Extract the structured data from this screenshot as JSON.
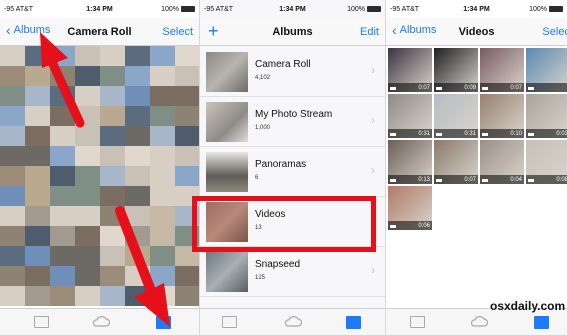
{
  "panel1": {
    "status": {
      "carrier": "-95 AT&T",
      "time": "1:34 PM",
      "battery": "100%"
    },
    "nav": {
      "back_label": "Albums",
      "title": "Camera Roll",
      "action": "Select"
    }
  },
  "panel2": {
    "status": {
      "carrier": "-95 AT&T",
      "time": "1:34 PM",
      "battery": "100%"
    },
    "nav": {
      "add": "+",
      "title": "Albums",
      "action": "Edit"
    },
    "albums": [
      {
        "name": "Camera Roll",
        "count": "4,102"
      },
      {
        "name": "My Photo Stream",
        "count": "1,000"
      },
      {
        "name": "Panoramas",
        "count": "6"
      },
      {
        "name": "Videos",
        "count": "13"
      },
      {
        "name": "Snapseed",
        "count": "125"
      }
    ]
  },
  "panel3": {
    "status": {
      "carrier": "-95 AT&T",
      "time": "1:34 PM",
      "battery": "100%"
    },
    "nav": {
      "back_label": "Albums",
      "title": "Videos",
      "action": "Select"
    },
    "videos": [
      "0:07",
      "0:09",
      "0:07",
      "",
      "0:31",
      "0:31",
      "0:10",
      "0:03",
      "0:13",
      "0:07",
      "0:04",
      "0:08",
      "0:06"
    ]
  },
  "watermark": "osxdaily.com",
  "colors": {
    "accent": "#1c7bf7",
    "highlight": "#e5101a"
  },
  "icons": {
    "tab_photos": "photos-tab-icon",
    "tab_cloud": "shared-cloud-icon",
    "tab_albums": "albums-tab-icon"
  }
}
